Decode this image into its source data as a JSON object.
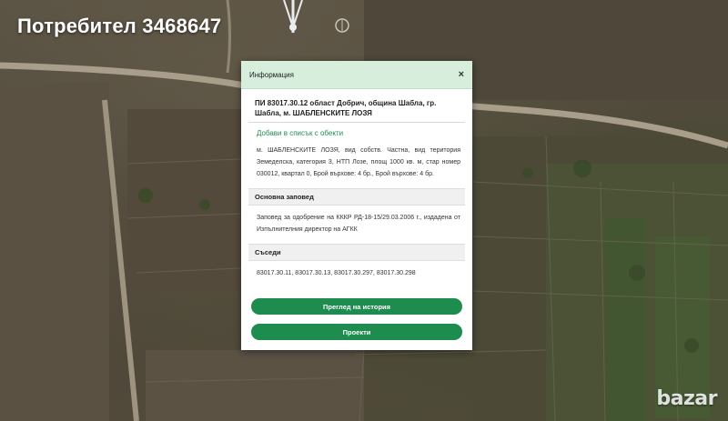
{
  "overlay": {
    "user_label": "Потребител 3468647",
    "logo_text": "bazar"
  },
  "dialog": {
    "title": "Информация",
    "close_symbol": "×",
    "parcel_title": "ПИ 83017.30.12 област Добрич, община Шабла, гр. Шабла, м. ШАБЛЕНСКИТЕ ЛОЗЯ",
    "add_link": "Добави в списък с обекти",
    "description": "м. ШАБЛЕНСКИТЕ ЛОЗЯ, вид собств. Частна, вид територия Земеделска, категория 3, НТП Лозе, площ 1000 кв. м, стар номер 030012, квартал 0, Брой върхове: 4 бр., Брой върхове: 4 бр.",
    "sections": {
      "order": {
        "heading": "Основна заповед",
        "text": "Заповед за одобрение на КККР РД-18-15/29.03.2006 г., издадена от Изпълнителния директор на АГКК"
      },
      "neighbors": {
        "heading": "Съседи",
        "text": "83017.30.11, 83017.30.13, 83017.30.297, 83017.30.298"
      }
    },
    "buttons": {
      "history": "Преглед на история",
      "projects": "Проекти"
    }
  },
  "icons": {
    "close": "close-icon",
    "map_marker": "map-marker-icon",
    "compass": "compass-icon"
  },
  "colors": {
    "accent": "#1e8c4e",
    "header_bg": "#d7eedd",
    "link": "#1f8f52"
  }
}
